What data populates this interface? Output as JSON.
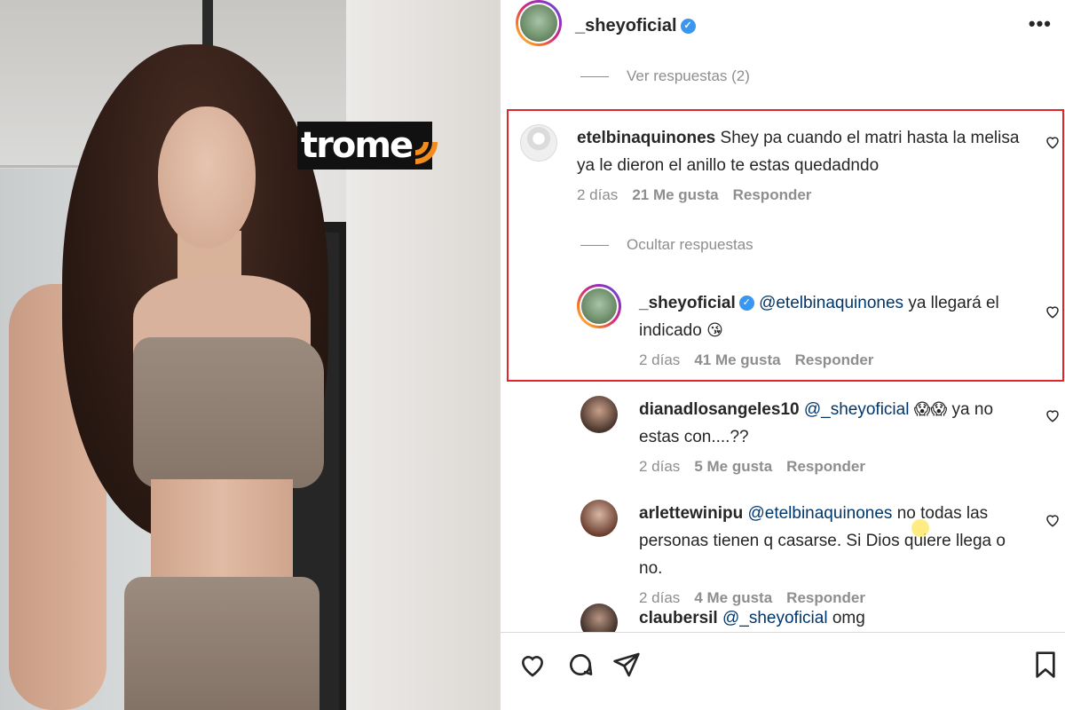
{
  "watermark": {
    "brand": "trome"
  },
  "header": {
    "username": "_sheyoficial",
    "more_label": "•••"
  },
  "thread": {
    "top_toggle": "Ver respuestas (2)",
    "main_comment": {
      "username": "etelbinaquinones",
      "text": "Shey pa cuando el matri hasta la melisa ya le dieron el anillo te estas quedadndo",
      "time": "2 días",
      "likes": "21 Me gusta",
      "reply": "Responder"
    },
    "hide_toggle": "Ocultar respuestas",
    "replies": [
      {
        "username": "_sheyoficial",
        "mention": "@etelbinaquinones",
        "text": "ya llegará el indicado",
        "emoji": "😘",
        "time": "2 días",
        "likes": "41 Me gusta",
        "reply": "Responder"
      },
      {
        "username": "dianadlosangeles10",
        "mention": "@_sheyoficial",
        "emoji": "😱😱",
        "text": "ya no estas con....??",
        "time": "2 días",
        "likes": "5 Me gusta",
        "reply": "Responder"
      },
      {
        "username": "arlettewinipu",
        "mention": "@etelbinaquinones",
        "text": "no todas las personas tienen q casarse. Si Dios quiere llega o no.",
        "time": "2 días",
        "likes": "4 Me gusta",
        "reply": "Responder"
      },
      {
        "username": "claubersil",
        "mention": "@_sheyoficial",
        "text": "omg"
      }
    ]
  },
  "colors": {
    "accent_red": "#e0262a",
    "mention": "#00376b",
    "verified": "#3897f0"
  },
  "icons": [
    "heart-icon",
    "comment-icon",
    "share-icon",
    "bookmark-icon"
  ]
}
